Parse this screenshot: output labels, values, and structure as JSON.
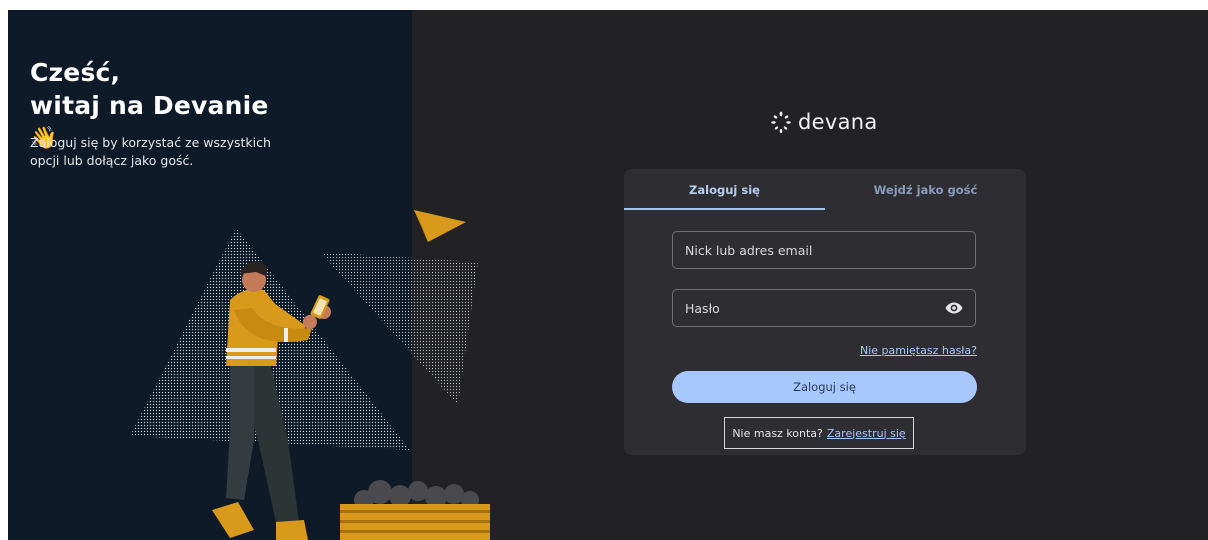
{
  "hero": {
    "title_line1": "Cześć,",
    "title_line2": "witaj na Devanie",
    "wave_emoji": "👋",
    "subtitle": "Zaloguj się by korzystać ze wszystkich opcji lub dołącz jako gość."
  },
  "brand": {
    "name": "devana",
    "icon": "devana-logo-icon"
  },
  "tabs": [
    {
      "label": "Zaloguj się",
      "active": true
    },
    {
      "label": "Wejdź jako gość",
      "active": false
    }
  ],
  "form": {
    "email_placeholder": "Nick lub adres email",
    "password_placeholder": "Hasło",
    "forgot_label": "Nie pamiętasz hasła?",
    "submit_label": "Zaloguj się",
    "no_account_text": "Nie masz konta?",
    "register_link": "Zarejestruj się"
  },
  "colors": {
    "left_panel": "#0e1a27",
    "right_panel": "#222225",
    "card": "#2e2e32",
    "accent": "#a8c8fb",
    "illustration_orange": "#d99a1c"
  }
}
